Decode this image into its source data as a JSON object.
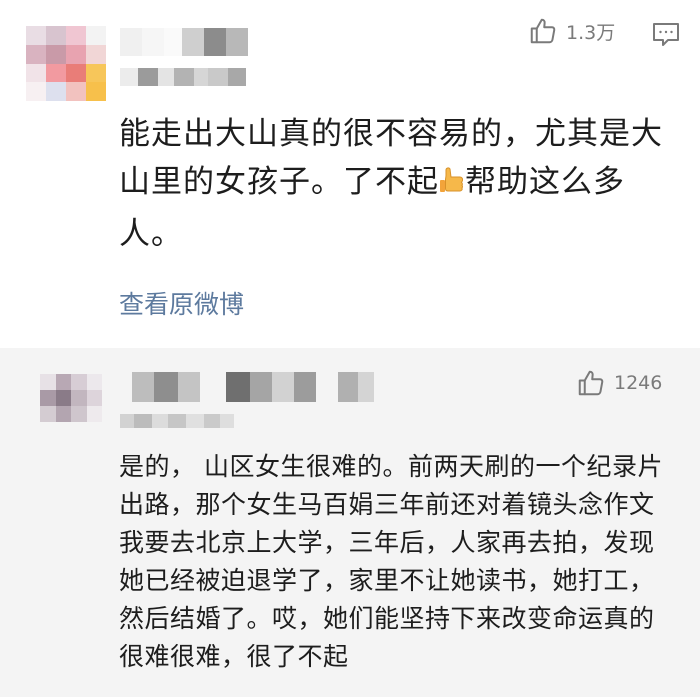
{
  "comments": [
    {
      "likes": "1.3万",
      "text_before_emoji": "能走出大山真的很不容易的，尤其是大山里的女孩子。了不起",
      "emoji": "thumbs-up-emoji",
      "text_after_emoji": "帮助这么多人。",
      "view_original": "查看原微博"
    },
    {
      "likes": "1246",
      "text": "是的， 山区女生很难的。前两天刷的一个纪录片出路，那个女生马百娟三年前还对着镜头念作文我要去北京上大学，三年后，人家再去拍，发现她已经被迫退学了，家里不让她读书，她打工，然后结婚了。哎，她们能坚持下来改变命运真的很难很难，很了不起"
    }
  ],
  "icons": [
    "thumbs-up-icon",
    "comment-icon",
    "thumbs-up-emoji"
  ],
  "colors": {
    "link": "#5d7a9e",
    "icon_gray": "#7a7a7a",
    "reply_background": "#f4f4f4"
  }
}
